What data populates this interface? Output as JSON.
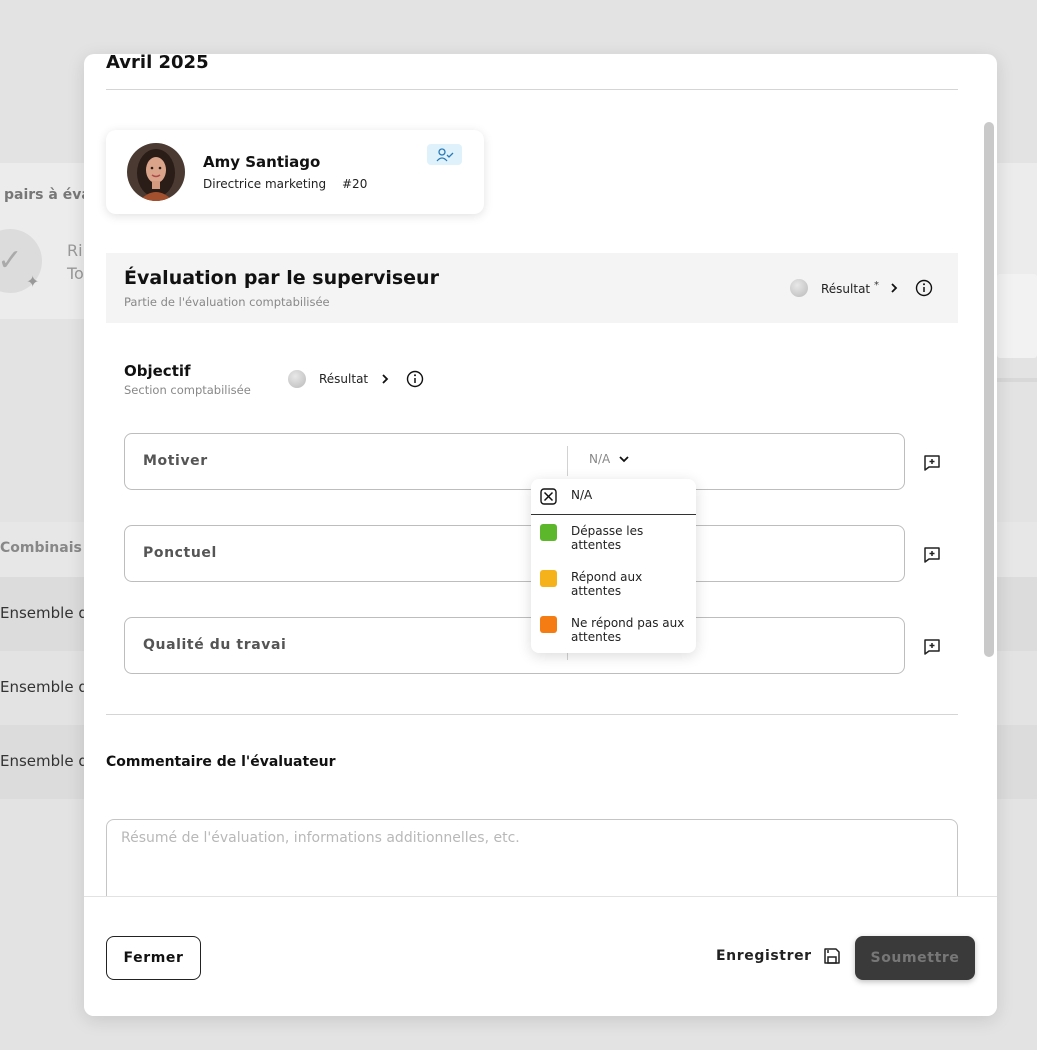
{
  "background": {
    "pairs_label": "pairs à éva",
    "ri_label": "Ri",
    "to_label": "To",
    "combi_label": "Combinais",
    "rows": [
      "Ensemble d",
      "Ensemble d",
      "Ensemble d"
    ]
  },
  "modal": {
    "month": "Avril 2025",
    "employee": {
      "name": "Amy Santiago",
      "role": "Directrice marketing",
      "id": "#20",
      "badge_icon": "user-check-icon"
    },
    "section": {
      "title": "Évaluation par le superviseur",
      "subtitle": "Partie de l'évaluation comptabilisée",
      "result_label": "Résultat",
      "required_mark": "*"
    },
    "objective": {
      "title": "Objectif",
      "subtitle": "Section comptabilisée",
      "result_label": "Résultat"
    },
    "criteria": [
      {
        "label": "Motiver",
        "value": "N/A"
      },
      {
        "label": "Ponctuel",
        "value": ""
      },
      {
        "label": "Qualité du travai",
        "value": ""
      }
    ],
    "dropdown": {
      "options": [
        {
          "label": "N/A",
          "color": "#ffffff"
        },
        {
          "label": "Dépasse les attentes",
          "color": "#5cb82a"
        },
        {
          "label": "Répond aux attentes",
          "color": "#f5b21a"
        },
        {
          "label": "Ne répond pas aux attentes",
          "color": "#f57c12"
        }
      ]
    },
    "comment": {
      "title": "Commentaire de l'évaluateur",
      "placeholder": "Résumé de l'évaluation, informations additionnelles, etc."
    },
    "footer": {
      "close_label": "Fermer",
      "save_label": "Enregistrer",
      "submit_label": "Soumettre"
    }
  }
}
